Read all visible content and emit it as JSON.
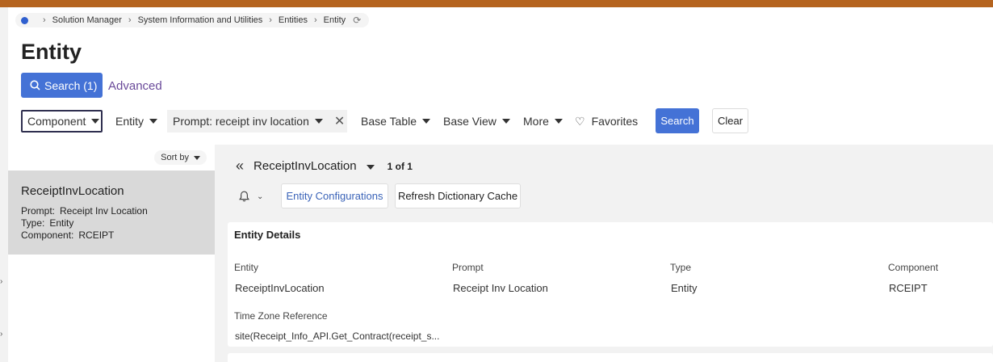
{
  "colors": {
    "top_bar": "#b5641f",
    "primary": "#4472d6",
    "home_dot": "#2f5fcf",
    "advanced": "#6a4a9a",
    "link": "#3a63b8",
    "selected_item": "#d9d9d9"
  },
  "icons": {
    "home": "home-dot-icon",
    "refresh": "refresh-icon",
    "search": "magnifier-icon",
    "close": "close-icon",
    "heart": "heart-icon",
    "double_chevron": "double-chevron-left-icon",
    "bell": "bell-icon",
    "chevron_down": "chevron-down-icon"
  },
  "breadcrumb": [
    "Solution Manager",
    "System Information and Utilities",
    "Entities",
    "Entity"
  ],
  "page_title": "Entity",
  "search_count_label": "Search (1)",
  "advanced_label": "Advanced",
  "filters": {
    "component": "Component",
    "entity": "Entity",
    "prompt": "Prompt: receipt inv location",
    "base_table": "Base Table",
    "base_view": "Base View",
    "more": "More",
    "favorites": "Favorites",
    "search": "Search",
    "clear": "Clear"
  },
  "list": {
    "sort_by": "Sort by",
    "item": {
      "title": "ReceiptInvLocation",
      "prompt_label": "Prompt:",
      "prompt_value": "Receipt Inv Location",
      "type_label": "Type:",
      "type_value": "Entity",
      "component_label": "Component:",
      "component_value": "RCEIPT"
    }
  },
  "detail": {
    "record_name": "ReceiptInvLocation",
    "record_count": "1 of 1",
    "entity_configurations": "Entity Configurations",
    "refresh_dictionary_cache": "Refresh Dictionary Cache",
    "card_title": "Entity Details",
    "fields": {
      "entity_label": "Entity",
      "entity_value": "ReceiptInvLocation",
      "prompt_label": "Prompt",
      "prompt_value": "Receipt Inv Location",
      "type_label": "Type",
      "type_value": "Entity",
      "component_label": "Component",
      "component_value": "RCEIPT",
      "tz_label": "Time Zone Reference",
      "tz_value": "site(Receipt_Info_API.Get_Contract(receipt_s..."
    }
  }
}
